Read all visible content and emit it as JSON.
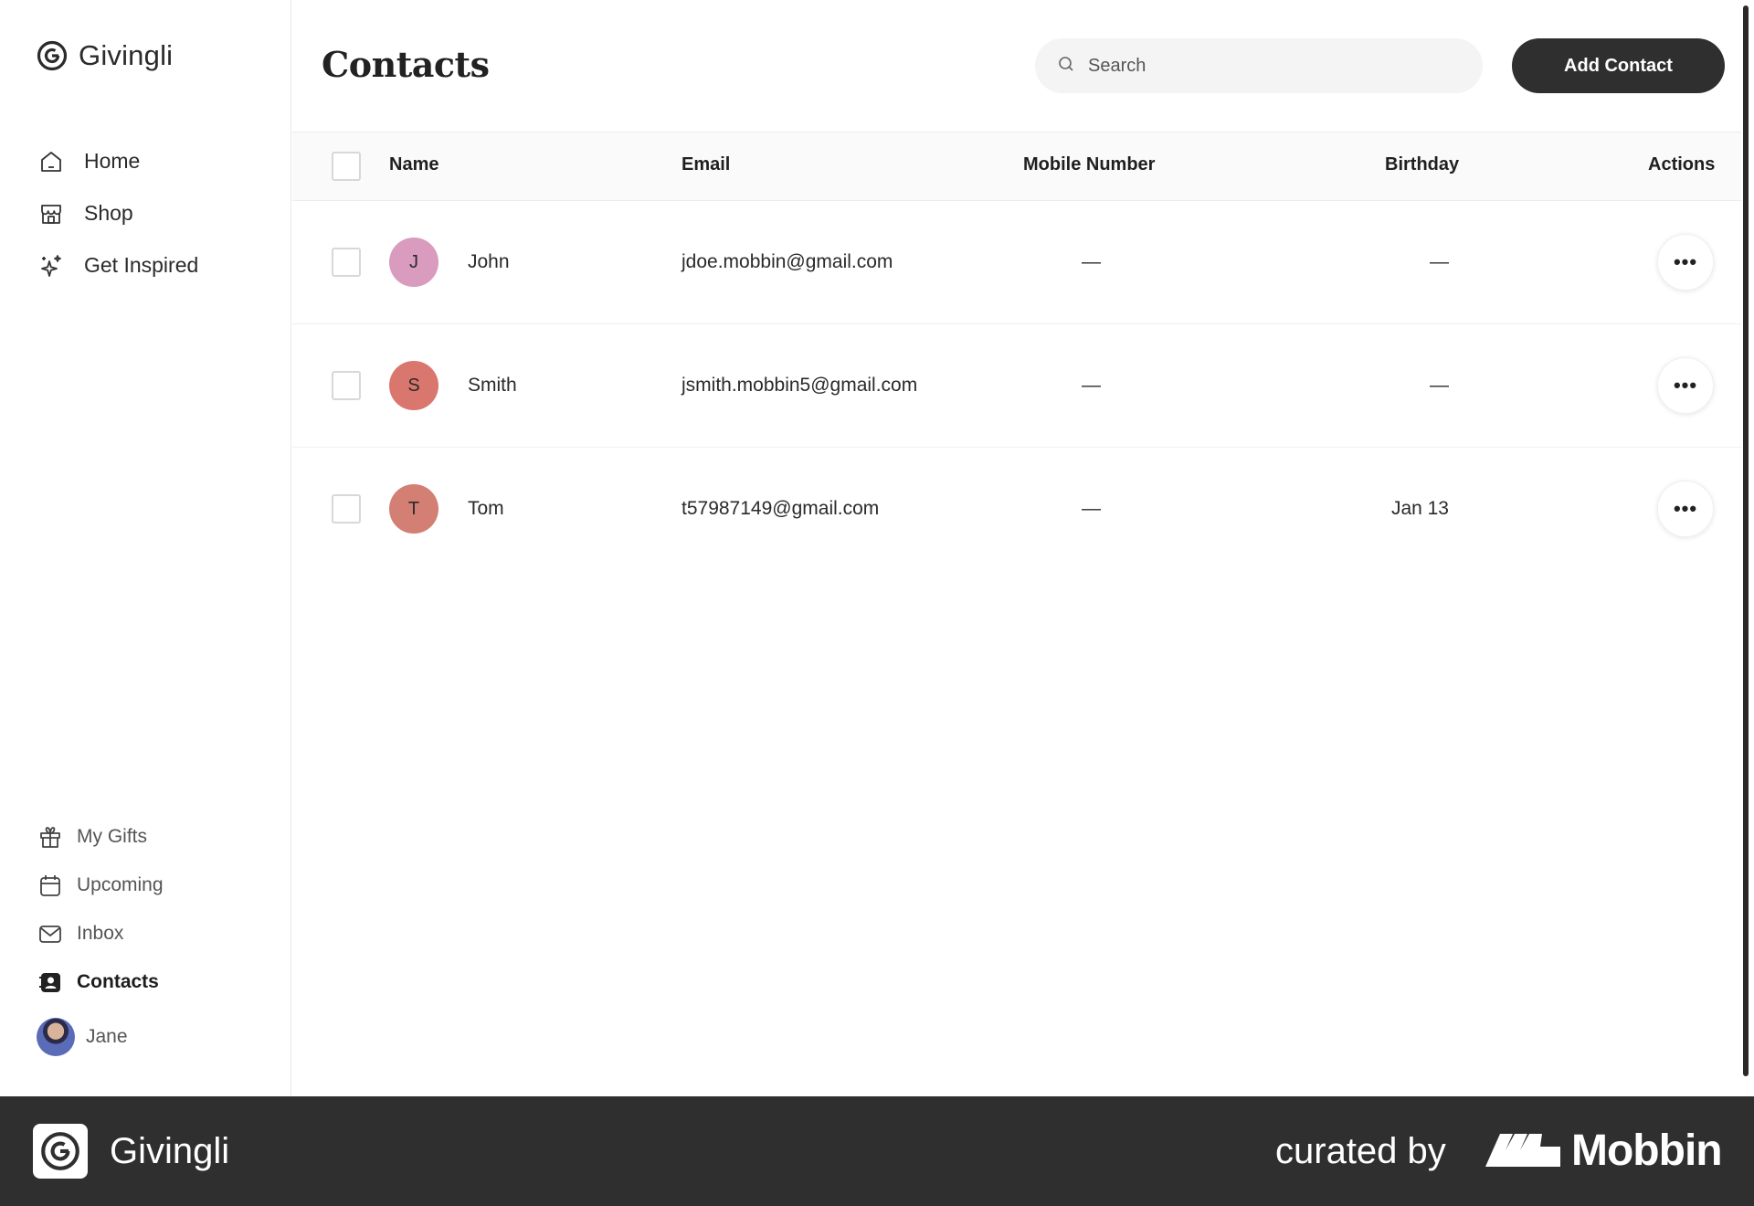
{
  "app": {
    "name": "Givingli"
  },
  "sidebar": {
    "primary": [
      {
        "label": "Home",
        "icon": "home-icon"
      },
      {
        "label": "Shop",
        "icon": "shop-icon"
      },
      {
        "label": "Get Inspired",
        "icon": "sparkles-icon"
      }
    ],
    "secondary": [
      {
        "label": "My Gifts",
        "icon": "gift-icon"
      },
      {
        "label": "Upcoming",
        "icon": "calendar-icon"
      },
      {
        "label": "Inbox",
        "icon": "mail-icon"
      },
      {
        "label": "Contacts",
        "icon": "contacts-icon",
        "active": true
      }
    ],
    "user": {
      "name": "Jane"
    }
  },
  "header": {
    "title": "Contacts",
    "search_placeholder": "Search",
    "add_button": "Add Contact"
  },
  "table": {
    "columns": [
      "Name",
      "Email",
      "Mobile Number",
      "Birthday",
      "Actions"
    ],
    "rows": [
      {
        "initial": "J",
        "name": "John",
        "email": "jdoe.mobbin@gmail.com",
        "mobile": "—",
        "birthday": "—",
        "avatar_color": "#d99bbe"
      },
      {
        "initial": "S",
        "name": "Smith",
        "email": "jsmith.mobbin5@gmail.com",
        "mobile": "—",
        "birthday": "—",
        "avatar_color": "#d9776f"
      },
      {
        "initial": "T",
        "name": "Tom",
        "email": "t57987149@gmail.com",
        "mobile": "—",
        "birthday": "Jan 13",
        "avatar_color": "#d47f74"
      }
    ],
    "actions_glyph": "•••"
  },
  "footer": {
    "brand": "Givingli",
    "curated_by": "curated by",
    "mobbin": "Mobbin"
  }
}
